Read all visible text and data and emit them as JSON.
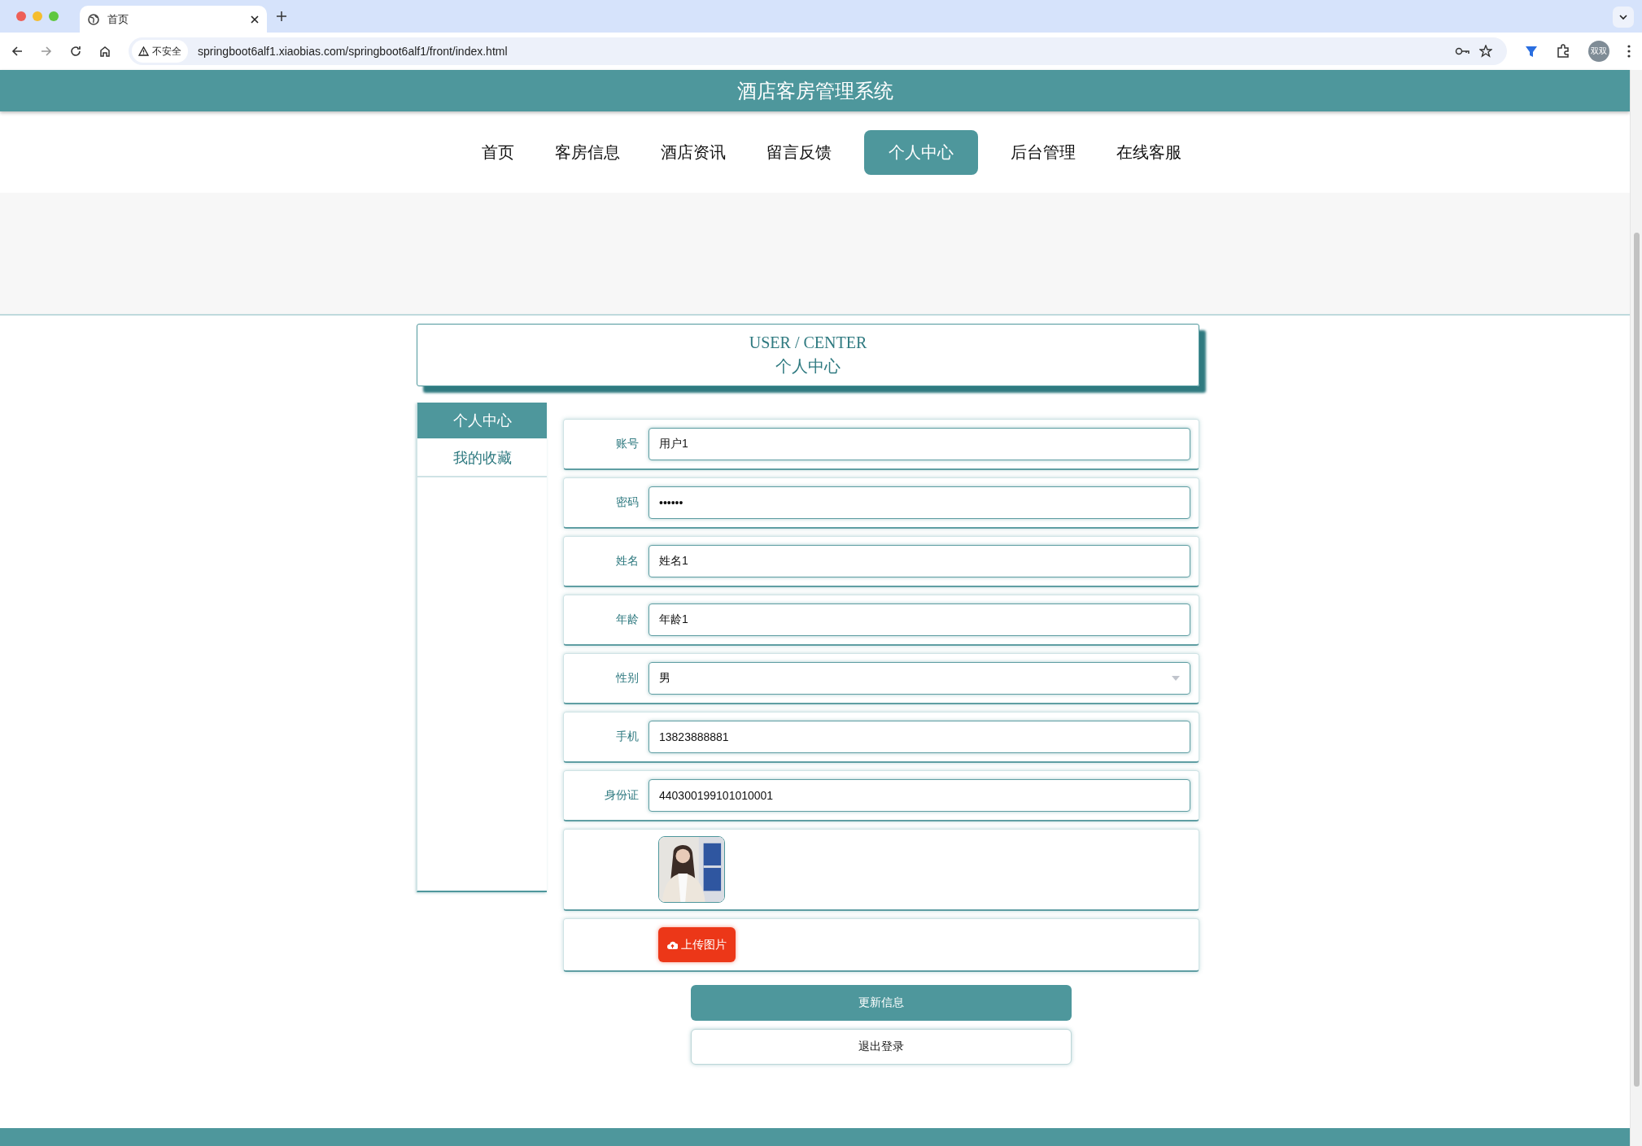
{
  "browser": {
    "tab_title": "首页",
    "security_label": "不安全",
    "url": "springboot6alf1.xiaobias.com/springboot6alf1/front/index.html",
    "profile_label": "双双"
  },
  "header": {
    "title": "酒店客房管理系统"
  },
  "nav": [
    {
      "label": "首页",
      "selected": false
    },
    {
      "label": "客房信息",
      "selected": false
    },
    {
      "label": "酒店资讯",
      "selected": false
    },
    {
      "label": "留言反馈",
      "selected": false
    },
    {
      "label": "个人中心",
      "selected": true
    },
    {
      "label": "后台管理",
      "selected": false
    },
    {
      "label": "在线客服",
      "selected": false
    }
  ],
  "user_center": {
    "title_en": "USER / CENTER",
    "title_cn": "个人中心"
  },
  "sidebar": [
    {
      "label": "个人中心",
      "selected": true
    },
    {
      "label": "我的收藏",
      "selected": false
    }
  ],
  "form": {
    "fields": [
      {
        "label": "账号",
        "kind": "text",
        "value": "用户1"
      },
      {
        "label": "密码",
        "kind": "password",
        "value": "••••••"
      },
      {
        "label": "姓名",
        "kind": "text",
        "value": "姓名1"
      },
      {
        "label": "年龄",
        "kind": "text",
        "value": "年龄1"
      },
      {
        "label": "性别",
        "kind": "select",
        "value": "男"
      },
      {
        "label": "手机",
        "kind": "text",
        "value": "13823888881"
      },
      {
        "label": "身份证",
        "kind": "text",
        "value": "440300199101010001"
      }
    ],
    "upload_button": "上传图片"
  },
  "buttons": [
    {
      "label": "更新信息",
      "kind": "primary"
    },
    {
      "label": "退出登录",
      "kind": "secondary"
    }
  ]
}
